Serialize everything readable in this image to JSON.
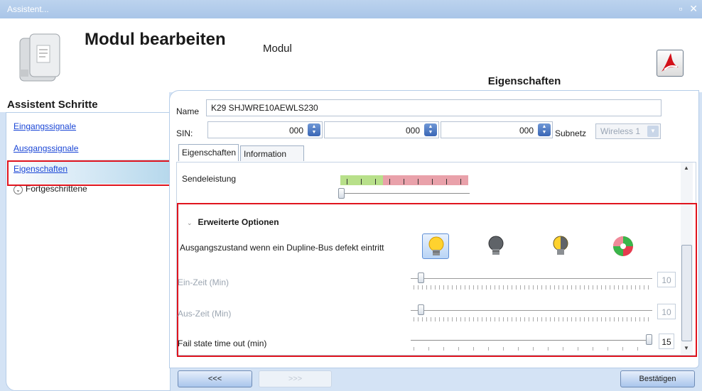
{
  "window": {
    "title": "Assistent...",
    "restore_glyph": "▫",
    "close_glyph": "✕"
  },
  "header": {
    "title": "Modul bearbeiten",
    "subtitle": "Modul",
    "device_icon": "device-module-icon",
    "pdf_icon": "pdf-icon"
  },
  "panel_header": {
    "title": "Eigenschaften"
  },
  "left": {
    "title": "Assistent Schritte",
    "steps": [
      {
        "label": "Eingangssignale"
      },
      {
        "label": "Ausgangssignale"
      },
      {
        "label": "Eigenschaften",
        "active": true
      },
      {
        "label": "Fortgeschrittene"
      }
    ],
    "expand_glyph": "✓"
  },
  "form": {
    "name_label": "Name",
    "name_value": "K29 SHJWRE10AEWLS230",
    "sin_label": "SIN:",
    "sin_values": [
      "000",
      "000",
      "000"
    ],
    "subnet_label": "Subnetz",
    "subnet_value": "Wireless 1"
  },
  "tabs": [
    {
      "label": "Eigenschaften",
      "active": true
    },
    {
      "label": "Information",
      "active": false
    }
  ],
  "properties": {
    "transmit_power_label": "Sendeleistung",
    "advanced_title": "Erweiterte Optionen",
    "output_state_label": "Ausgangszustand wenn ein Dupline-Bus defekt eintritt",
    "output_options": [
      {
        "icon": "bulb-on-icon",
        "selected": true
      },
      {
        "icon": "bulb-off-icon",
        "selected": false
      },
      {
        "icon": "bulb-last-state-icon",
        "selected": false
      },
      {
        "icon": "bulb-toggle-icon",
        "selected": false
      }
    ],
    "on_time_label": "Ein-Zeit (Min)",
    "on_time_value": "10",
    "off_time_label": "Aus-Zeit (Min)",
    "off_time_value": "10",
    "fail_timeout_label": "Fail state time out (min)",
    "fail_timeout_value": "15"
  },
  "buttons": {
    "back": "<<<",
    "next": ">>>",
    "confirm": "Bestätigen"
  },
  "colors": {
    "accent_red": "#e0141e",
    "link_blue": "#1a46d6",
    "power_green": "#b8e08a",
    "power_pink": "#e9a1aa"
  }
}
